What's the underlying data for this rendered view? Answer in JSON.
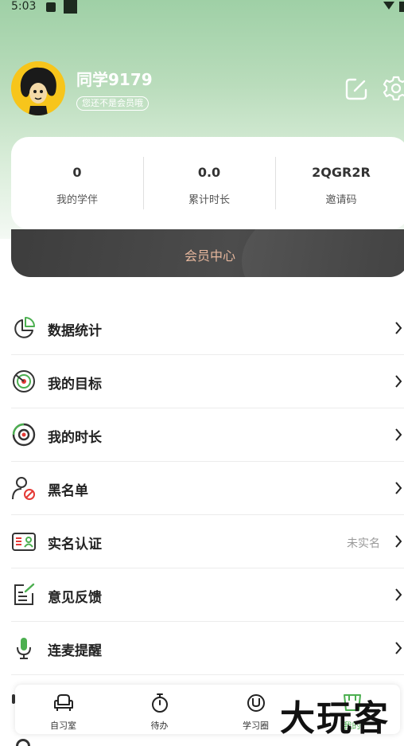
{
  "status_bar": {
    "time": "5:03"
  },
  "profile": {
    "username": "同学9179",
    "membership_badge": "您还不是会员哦"
  },
  "stats": [
    {
      "value": "0",
      "label": "我的学伴"
    },
    {
      "value": "0.0",
      "label": "累计时长"
    },
    {
      "value": "2QGR2R",
      "label": "邀请码"
    }
  ],
  "member_center": {
    "label": "会员中心"
  },
  "menu": [
    {
      "label": "数据统计",
      "icon": "pie-chart-icon"
    },
    {
      "label": "我的目标",
      "icon": "target-icon"
    },
    {
      "label": "我的时长",
      "icon": "record-icon"
    },
    {
      "label": "黑名单",
      "icon": "user-blocked-icon"
    },
    {
      "label": "实名认证",
      "icon": "id-card-icon",
      "value": "未实名"
    },
    {
      "label": "意见反馈",
      "icon": "feedback-edit-icon"
    },
    {
      "label": "连麦提醒",
      "icon": "microphone-icon"
    }
  ],
  "tabs": [
    {
      "label": "自习室",
      "icon": "sofa-icon"
    },
    {
      "label": "待办",
      "icon": "stopwatch-icon"
    },
    {
      "label": "学习圈",
      "icon": "circle-icon"
    },
    {
      "label": "我的",
      "icon": "profile-icon",
      "active": true
    }
  ],
  "watermark": "大玩客",
  "colors": {
    "accent": "#4caf50",
    "member_text": "#e6b79d",
    "header_green": "#9fd0a6"
  }
}
